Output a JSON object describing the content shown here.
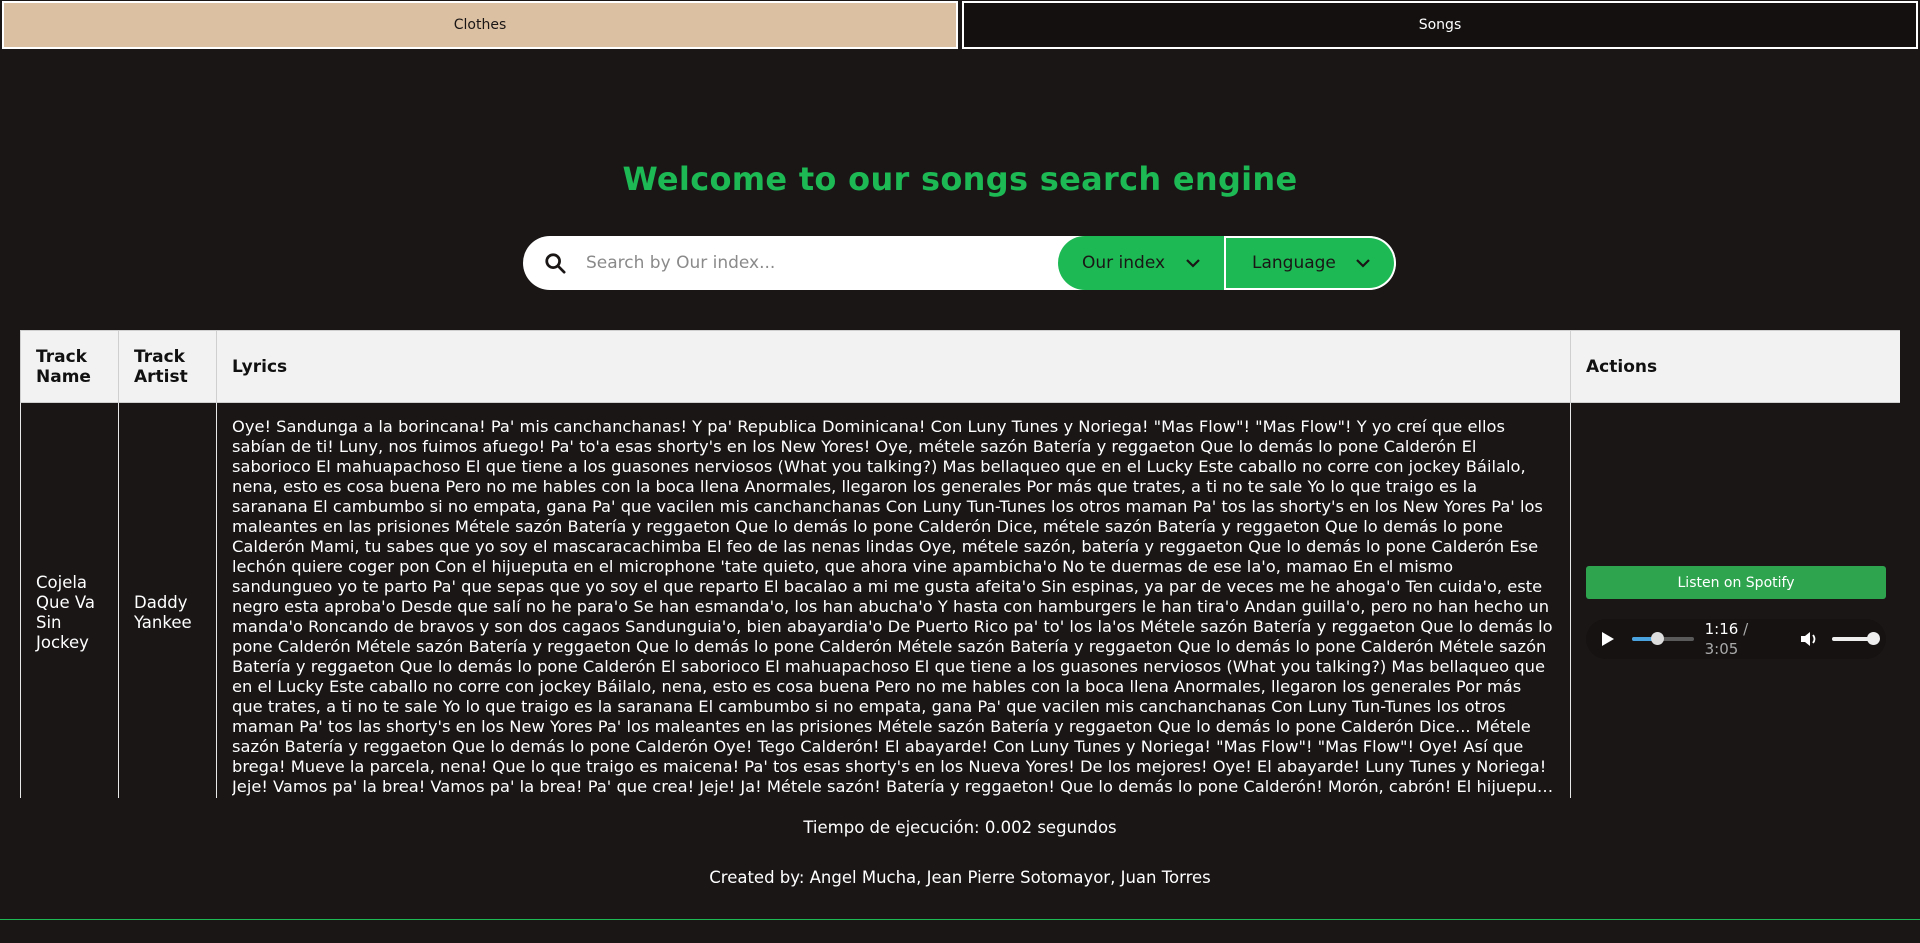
{
  "tabs": [
    {
      "label": "Clothes",
      "active": false
    },
    {
      "label": "Songs",
      "active": true
    }
  ],
  "header": {
    "title": "Welcome to our songs search engine"
  },
  "search": {
    "placeholder": "Search by Our index...",
    "value": "",
    "index_label": "Our index",
    "language_label": "Language"
  },
  "table": {
    "columns": [
      "Track Name",
      "Track Artist",
      "Lyrics",
      "Actions"
    ],
    "rows": [
      {
        "track_name": "Cojela Que Va Sin Jockey",
        "track_artist": "Daddy Yankee",
        "lyrics": "Oye! Sandunga a la borincana! Pa' mis canchanchanas! Y pa' Republica Dominicana! Con Luny Tunes y Noriega! \"Mas Flow\"! \"Mas Flow\"! Y yo creí que ellos sabían de ti! Luny, nos fuimos afuego! Pa' to'a esas shorty's en los New Yores! Oye, métele sazón Batería y reggaeton Que lo demás lo pone Calderón El saborioco El mahuapachoso El que tiene a los guasones nerviosos (What you talking?) Mas bellaqueo que en el Lucky Este caballo no corre con jockey Báilalo, nena, esto es cosa buena Pero no me hables con la boca llena Anormales, llegaron los generales Por más que trates, a ti no te sale Yo lo que traigo es la saranana El cambumbo si no empata, gana Pa' que vacilen mis canchanchanas Con Luny Tun-Tunes los otros maman Pa' tos las shorty's en los New Yores Pa' los maleantes en las prisiones Métele sazón Batería y reggaeton Que lo demás lo pone Calderón Dice, métele sazón Batería y reggaeton Que lo demás lo pone Calderón Mami, tu sabes que yo soy el mascaracachimba El feo de las nenas lindas Oye, métele sazón, batería y reggaeton Que lo demás lo pone Calderón Ese lechón quiere coger pon Con el hijueputa en el microphone 'tate quieto, que ahora vine apambicha'o No te duermas de ese la'o, mamao En el mismo sandungueo yo te parto Pa' que sepas que yo soy el que reparto El bacalao a mi me gusta afeita'o Sin espinas, ya par de veces me he ahoga'o Ten cuida'o, este negro esta aproba'o Desde que salí no he para'o Se han esmanda'o, los han abucha'o Y hasta con hamburgers le han tira'o Andan guilla'o, pero no han hecho un manda'o Roncando de bravos y son dos cagaos Sandunguia'o, bien abayardia'o De Puerto Rico pa' to' los la'os Métele sazón Batería y reggaeton Que lo demás lo pone Calderón Métele sazón Batería y reggaeton Que lo demás lo pone Calderón Métele sazón Batería y reggaeton Que lo demás lo pone Calderón Métele sazón Batería y reggaeton Que lo demás lo pone Calderón El saborioco El mahuapachoso El que tiene a los guasones nerviosos (What you talking?) Mas bellaqueo que en el Lucky Este caballo no corre con jockey Báilalo, nena, esto es cosa buena Pero no me hables con la boca llena Anormales, llegaron los generales Por más que trates, a ti no te sale Yo lo que traigo es la saranana El cambumbo si no empata, gana Pa' que vacilen mis canchanchanas Con Luny Tun-Tunes los otros maman Pa' tos las shorty's en los New Yores Pa' los maleantes en las prisiones Métele sazón Batería y reggaeton Que lo demás lo pone Calderón Dice... Métele sazón Batería y reggaeton Que lo demás lo pone Calderón Oye! Tego Calderón! El abayarde! Con Luny Tunes y Noriega! \"Mas Flow\"! \"Mas Flow\"! Oye! Así que brega! Mueve la parcela, nena! Que lo que traigo es maicena! Pa' tos esas shorty's en los Nueva Yores! De los mejores! Oye! El abayarde! Luny Tunes y Noriega! Jeje! Vamos pa' la brea! Vamos pa' la brea! Pa' que crea! Jeje! Ja! Métele sazón! Batería y reggaeton! Que lo demás lo pone Calderón! Morón, cabrón! El hijueputa en el microphone! Hey! Oye, Con Luny Tunes y Noriega! Je! Yo creí que ellos sabían de ti! Luny, nos fuimos afuego!",
        "spotify_label": "Listen on Spotify",
        "audio": {
          "current": "1:16",
          "separator": "/",
          "duration": "3:05",
          "progress_fraction": 0.41,
          "volume_fraction": 1.0
        }
      }
    ]
  },
  "footer": {
    "exec_time": "Tiempo de ejecución: 0.002 segundos",
    "credits": "Created by: Angel Mucha, Jean Pierre Sotomayor, Juan Torres"
  },
  "colors": {
    "background": "#1a1616",
    "accent": "#1db954",
    "tab_clothes": "#dbc0a2",
    "spotify_button": "#2ea44f"
  },
  "icons": {
    "search": "search-icon",
    "chevron": "chevron-down-icon",
    "play": "play-icon",
    "volume": "volume-icon"
  }
}
